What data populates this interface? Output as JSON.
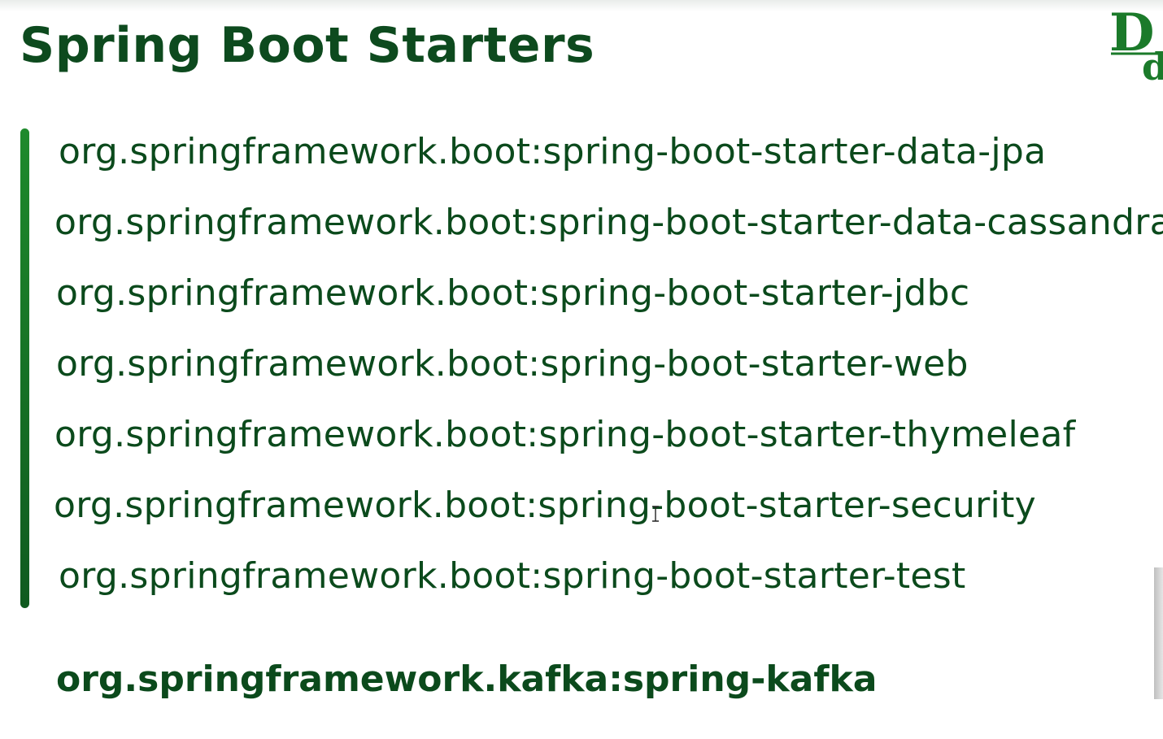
{
  "slide": {
    "title": "Spring Boot Starters",
    "starters": [
      "org.springframework.boot:spring-boot-starter-data-jpa",
      "org.springframework.boot:spring-boot-starter-data-cassandra",
      "org.springframework.boot:spring-boot-starter-jdbc",
      "org.springframework.boot:spring-boot-starter-web",
      "org.springframework.boot:spring-boot-starter-thymeleaf",
      "org.springframework.boot:spring-boot-starter-security",
      "org.springframework.boot:spring-boot-starter-test"
    ],
    "extra_dependency": "org.springframework.kafka:spring-kafka"
  },
  "logo": {
    "text": "Dd",
    "color": "#1b7a2a"
  },
  "colors": {
    "text": "#0b4a1c",
    "accent_bar": "#1e8a2c"
  },
  "icons": {
    "cursor": "text-cursor-icon"
  }
}
